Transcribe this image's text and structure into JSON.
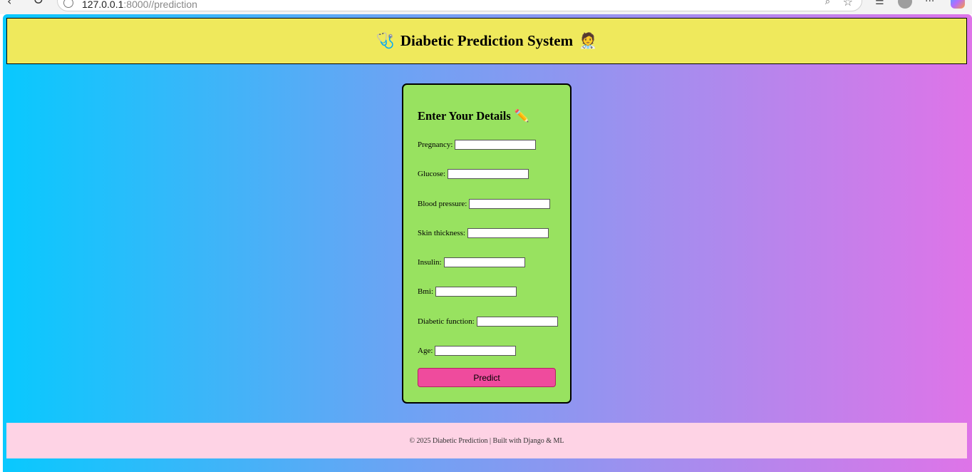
{
  "browser": {
    "url_host": "127.0.0.1",
    "url_port": ":8000",
    "url_path": "//prediction"
  },
  "header": {
    "title": "Diabetic Prediction System",
    "icon_left": "🩺",
    "icon_right": "🧑‍⚕️"
  },
  "form": {
    "heading": "Enter Your Details",
    "heading_icon": "✏️",
    "fields": [
      {
        "label": "Pregnancy:",
        "value": ""
      },
      {
        "label": "Glucose:",
        "value": ""
      },
      {
        "label": "Blood pressure:",
        "value": ""
      },
      {
        "label": "Skin thickness:",
        "value": ""
      },
      {
        "label": "Insulin:",
        "value": ""
      },
      {
        "label": "Bmi:",
        "value": ""
      },
      {
        "label": "Diabetic function:",
        "value": ""
      },
      {
        "label": "Age:",
        "value": ""
      }
    ],
    "submit_label": "Predict"
  },
  "footer": {
    "text": "© 2025 Diabetic Prediction | Built with Django & ML"
  },
  "colors": {
    "header_bg": "#efe95c",
    "card_bg": "#98e260",
    "button_bg": "#ef4b9d",
    "footer_bg": "#fed3e5",
    "gradient_start": "#08c9fe",
    "gradient_end": "#de74e8"
  }
}
